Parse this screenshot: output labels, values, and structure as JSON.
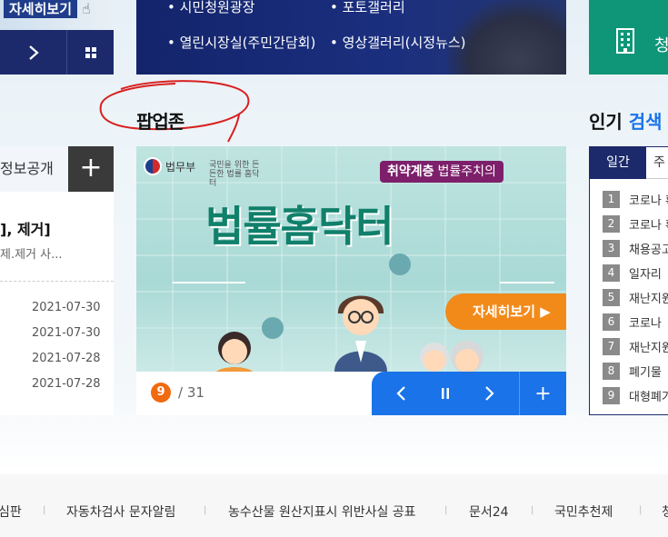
{
  "top_left": {
    "more_label": "자세히보기"
  },
  "banner": {
    "links": [
      "시민청원광장",
      "포토갤러리",
      "열린시장실(주민간담회)",
      "영상갤러리(시정뉴스)"
    ]
  },
  "green_box": {
    "label": "청"
  },
  "sections": {
    "popup_title": "팝업존",
    "popular_title_a": "인기",
    "popular_title_b": "검색"
  },
  "left_panel": {
    "tab_label": "정보공개",
    "headline": "], 제거]",
    "subline": "제.제거 사...",
    "dates": [
      "2021-07-30",
      "2021-07-30",
      "2021-07-28",
      "2021-07-28"
    ]
  },
  "popup": {
    "org": "법무부",
    "org_small": "국민을 위한 든든한 법률 홈닥터",
    "tagline_a": "취약계층",
    "tagline_b": "법률주치의",
    "title": "법률홈닥터",
    "detail_label": "자세히보기 ▶",
    "current_page": "9",
    "total_pages": "/ 31"
  },
  "keywords": {
    "tab_daily": "일간",
    "tab_next": "주",
    "items": [
      {
        "rank": "1",
        "text": "코로나 확"
      },
      {
        "rank": "2",
        "text": "코로나 확"
      },
      {
        "rank": "3",
        "text": "채용공고"
      },
      {
        "rank": "4",
        "text": "일자리"
      },
      {
        "rank": "5",
        "text": "재난지원"
      },
      {
        "rank": "6",
        "text": "코로나"
      },
      {
        "rank": "7",
        "text": "재난지원"
      },
      {
        "rank": "8",
        "text": "폐기물"
      },
      {
        "rank": "9",
        "text": "대형폐기"
      }
    ]
  },
  "footer": {
    "links": [
      "심판",
      "자동차검사 문자알림",
      "농수산물 원산지표시 위반사실 공표",
      "문서24",
      "국민추천제",
      "청"
    ]
  },
  "icons": {
    "next": "chevron-right-icon",
    "grid": "grid-icon",
    "building": "building-icon",
    "plus": "plus-icon",
    "prev": "chevron-left-icon",
    "pause": "pause-icon"
  },
  "colors": {
    "navy": "#1c2a6b",
    "blue": "#1a73e8",
    "green": "#0f9678",
    "orange": "#f28a1a",
    "annotation_red": "#d92020"
  }
}
